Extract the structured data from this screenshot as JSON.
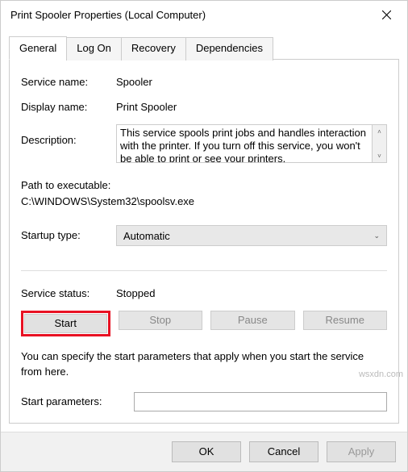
{
  "window": {
    "title": "Print Spooler Properties (Local Computer)"
  },
  "tabs": {
    "general": "General",
    "logon": "Log On",
    "recovery": "Recovery",
    "dependencies": "Dependencies"
  },
  "labels": {
    "service_name": "Service name:",
    "display_name": "Display name:",
    "description": "Description:",
    "path_to_exe": "Path to executable:",
    "startup_type": "Startup type:",
    "service_status": "Service status:",
    "start_parameters": "Start parameters:"
  },
  "values": {
    "service_name": "Spooler",
    "display_name": "Print Spooler",
    "description": "This service spools print jobs and handles interaction with the printer.  If you turn off this service, you won't be able to print or see your printers.",
    "path": "C:\\WINDOWS\\System32\\spoolsv.exe",
    "startup_type": "Automatic",
    "service_status": "Stopped",
    "start_parameters": ""
  },
  "buttons": {
    "start": "Start",
    "stop": "Stop",
    "pause": "Pause",
    "resume": "Resume",
    "ok": "OK",
    "cancel": "Cancel",
    "apply": "Apply"
  },
  "note": "You can specify the start parameters that apply when you start the service from here.",
  "watermark": "wsxdn.com"
}
